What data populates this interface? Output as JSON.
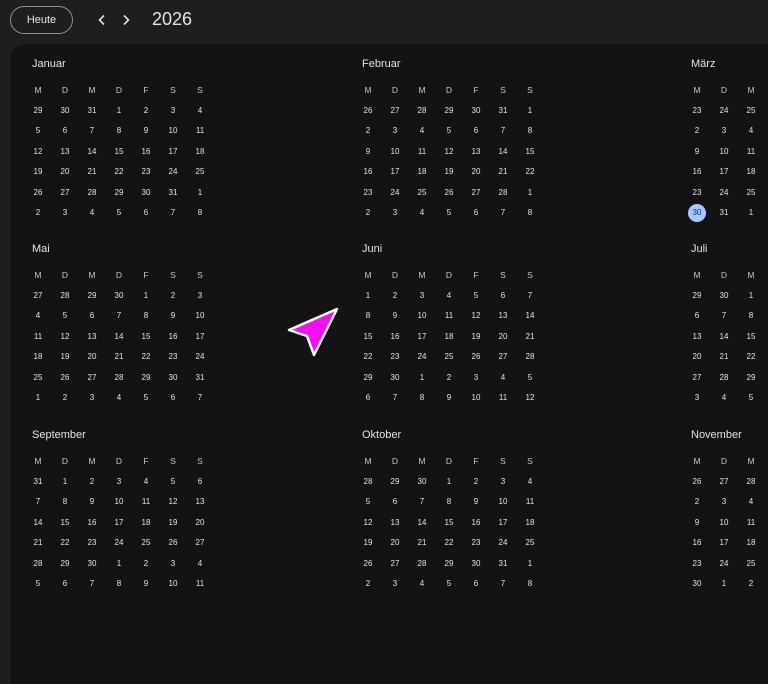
{
  "toolbar": {
    "today_label": "Heute",
    "prev_icon": "chevron-left-icon",
    "next_icon": "chevron-right-icon",
    "year": "2026"
  },
  "weekdays": [
    "M",
    "D",
    "M",
    "D",
    "F",
    "S",
    "S"
  ],
  "today": {
    "month": 2,
    "day": "30"
  },
  "months": [
    {
      "name": "Januar",
      "weeks": [
        [
          "29",
          "30",
          "31",
          "1",
          "2",
          "3",
          "4"
        ],
        [
          "5",
          "6",
          "7",
          "8",
          "9",
          "10",
          "11"
        ],
        [
          "12",
          "13",
          "14",
          "15",
          "16",
          "17",
          "18"
        ],
        [
          "19",
          "20",
          "21",
          "22",
          "23",
          "24",
          "25"
        ],
        [
          "26",
          "27",
          "28",
          "29",
          "30",
          "31",
          "1"
        ],
        [
          "2",
          "3",
          "4",
          "5",
          "6",
          "7",
          "8"
        ]
      ]
    },
    {
      "name": "Februar",
      "weeks": [
        [
          "26",
          "27",
          "28",
          "29",
          "30",
          "31",
          "1"
        ],
        [
          "2",
          "3",
          "4",
          "5",
          "6",
          "7",
          "8"
        ],
        [
          "9",
          "10",
          "11",
          "12",
          "13",
          "14",
          "15"
        ],
        [
          "16",
          "17",
          "18",
          "19",
          "20",
          "21",
          "22"
        ],
        [
          "23",
          "24",
          "25",
          "26",
          "27",
          "28",
          "1"
        ],
        [
          "2",
          "3",
          "4",
          "5",
          "6",
          "7",
          "8"
        ]
      ]
    },
    {
      "name": "März",
      "weeks": [
        [
          "23",
          "24",
          "25"
        ],
        [
          "2",
          "3",
          "4"
        ],
        [
          "9",
          "10",
          "11"
        ],
        [
          "16",
          "17",
          "18"
        ],
        [
          "23",
          "24",
          "25"
        ],
        [
          "30",
          "31",
          "1"
        ]
      ]
    },
    {
      "name": "Mai",
      "weeks": [
        [
          "27",
          "28",
          "29",
          "30",
          "1",
          "2",
          "3"
        ],
        [
          "4",
          "5",
          "6",
          "7",
          "8",
          "9",
          "10"
        ],
        [
          "11",
          "12",
          "13",
          "14",
          "15",
          "16",
          "17"
        ],
        [
          "18",
          "19",
          "20",
          "21",
          "22",
          "23",
          "24"
        ],
        [
          "25",
          "26",
          "27",
          "28",
          "29",
          "30",
          "31"
        ],
        [
          "1",
          "2",
          "3",
          "4",
          "5",
          "6",
          "7"
        ]
      ]
    },
    {
      "name": "Juni",
      "weeks": [
        [
          "1",
          "2",
          "3",
          "4",
          "5",
          "6",
          "7"
        ],
        [
          "8",
          "9",
          "10",
          "11",
          "12",
          "13",
          "14"
        ],
        [
          "15",
          "16",
          "17",
          "18",
          "19",
          "20",
          "21"
        ],
        [
          "22",
          "23",
          "24",
          "25",
          "26",
          "27",
          "28"
        ],
        [
          "29",
          "30",
          "1",
          "2",
          "3",
          "4",
          "5"
        ],
        [
          "6",
          "7",
          "8",
          "9",
          "10",
          "11",
          "12"
        ]
      ]
    },
    {
      "name": "Juli",
      "weeks": [
        [
          "29",
          "30",
          "1"
        ],
        [
          "6",
          "7",
          "8"
        ],
        [
          "13",
          "14",
          "15"
        ],
        [
          "20",
          "21",
          "22"
        ],
        [
          "27",
          "28",
          "29"
        ],
        [
          "3",
          "4",
          "5"
        ]
      ]
    },
    {
      "name": "September",
      "weeks": [
        [
          "31",
          "1",
          "2",
          "3",
          "4",
          "5",
          "6"
        ],
        [
          "7",
          "8",
          "9",
          "10",
          "11",
          "12",
          "13"
        ],
        [
          "14",
          "15",
          "16",
          "17",
          "18",
          "19",
          "20"
        ],
        [
          "21",
          "22",
          "23",
          "24",
          "25",
          "26",
          "27"
        ],
        [
          "28",
          "29",
          "30",
          "1",
          "2",
          "3",
          "4"
        ],
        [
          "5",
          "6",
          "7",
          "8",
          "9",
          "10",
          "11"
        ]
      ]
    },
    {
      "name": "Oktober",
      "weeks": [
        [
          "28",
          "29",
          "30",
          "1",
          "2",
          "3",
          "4"
        ],
        [
          "5",
          "6",
          "7",
          "8",
          "9",
          "10",
          "11"
        ],
        [
          "12",
          "13",
          "14",
          "15",
          "16",
          "17",
          "18"
        ],
        [
          "19",
          "20",
          "21",
          "22",
          "23",
          "24",
          "25"
        ],
        [
          "26",
          "27",
          "28",
          "29",
          "30",
          "31",
          "1"
        ],
        [
          "2",
          "3",
          "4",
          "5",
          "6",
          "7",
          "8"
        ]
      ]
    },
    {
      "name": "November",
      "weeks": [
        [
          "26",
          "27",
          "28"
        ],
        [
          "2",
          "3",
          "4"
        ],
        [
          "9",
          "10",
          "11"
        ],
        [
          "16",
          "17",
          "18"
        ],
        [
          "23",
          "24",
          "25"
        ],
        [
          "30",
          "1",
          "2"
        ]
      ]
    }
  ],
  "cursor_icon": "pointer-arrow-icon"
}
